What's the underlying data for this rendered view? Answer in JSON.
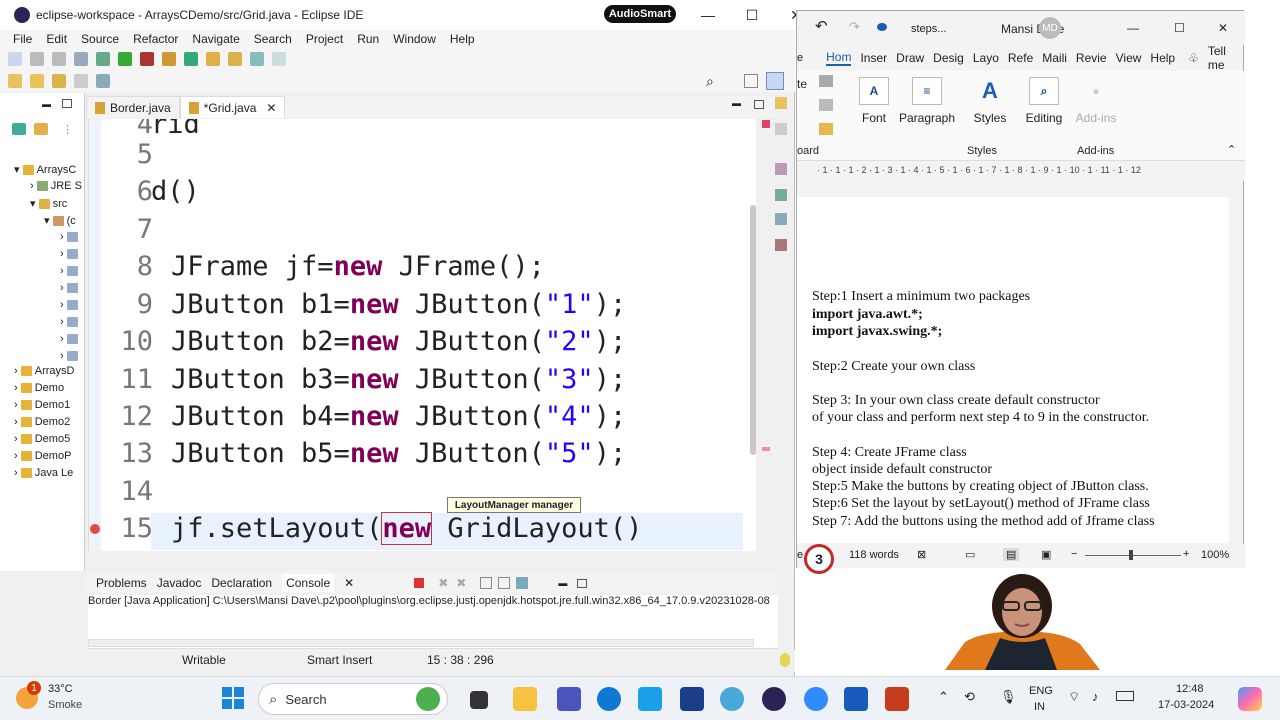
{
  "eclipse": {
    "title": "eclipse-workspace - ArraysCDemo/src/Grid.java - Eclipse IDE",
    "audiosmart": "AudioSmart",
    "menu": [
      "File",
      "Edit",
      "Source",
      "Refactor",
      "Navigate",
      "Search",
      "Project",
      "Run",
      "Window",
      "Help"
    ],
    "tree": [
      "ArraysC",
      "JRE S",
      "src",
      "(c",
      "ArraysD",
      "Demo",
      "Demo1",
      "Demo2",
      "Demo5",
      "DemoP",
      "Java Le"
    ],
    "tabs": {
      "border": "Border.java",
      "grid": "*Grid.java"
    },
    "editor": {
      "lines": [
        {
          "n": "4",
          "code": "rid"
        },
        {
          "n": "5",
          "code": ""
        },
        {
          "n": "6",
          "code": "d()"
        },
        {
          "n": "7",
          "code": ""
        },
        {
          "n": "8",
          "type": "JFrame jf=",
          "kw": "new",
          "rest": " JFrame();"
        },
        {
          "n": "9",
          "type": "JButton b1=",
          "kw": "new",
          "rest": " JButton(",
          "str": "\"1\"",
          "end": ");"
        },
        {
          "n": "10",
          "type": "JButton b2=",
          "kw": "new",
          "rest": " JButton(",
          "str": "\"2\"",
          "end": ");"
        },
        {
          "n": "11",
          "type": "JButton b3=",
          "kw": "new",
          "rest": " JButton(",
          "str": "\"3\"",
          "end": ");"
        },
        {
          "n": "12",
          "type": "JButton b4=",
          "kw": "new",
          "rest": " JButton(",
          "str": "\"4\"",
          "end": ");"
        },
        {
          "n": "13",
          "type": "JButton b5=",
          "kw": "new",
          "rest": " JButton(",
          "str": "\"5\"",
          "end": ");"
        },
        {
          "n": "14",
          "code": ""
        },
        {
          "n": "15",
          "type": "jf.setLayout(",
          "kw": "new",
          "rest": " GridLayout()"
        }
      ],
      "tooltip": "LayoutManager manager"
    },
    "console_tabs": [
      "Problems",
      "Javadoc",
      "Declaration",
      "Console"
    ],
    "console_path": "Border [Java Application] C:\\Users\\Mansi Dave\\.p2\\pool\\plugins\\org.eclipse.justj.openjdk.hotspot.jre.full.win32.x86_64_17.0.9.v20231028-08",
    "status": {
      "mode": "Writable",
      "insert": "Smart Insert",
      "pos": "15 : 38 : 296"
    }
  },
  "word": {
    "title": "steps...",
    "user": "Mansi Dave",
    "initials": "MD",
    "tabs": [
      "Hom",
      "Inser",
      "Draw",
      "Desig",
      "Layo",
      "Refe",
      "Maili",
      "Revie",
      "View",
      "Help",
      "Tell me"
    ],
    "ribbon": {
      "font": "Font",
      "paragraph": "Paragraph",
      "styles": "Styles",
      "editing": "Editing",
      "addins": "Add-ins",
      "styles_grp": "Styles",
      "addins_grp": "Add-ins",
      "board": "oard"
    },
    "ruler": "· 1 · 1 · 1 · 2 · 1 · 3 · 1 · 4 · 1 · 5 · 1 · 6 · 1 · 7 · 1 · 8 · 1 · 9 · 1 · 10 · 1 · 11 · 1 · 12",
    "doc": [
      {
        "t": "Step:1 Insert a minimum two packages",
        "b": false
      },
      {
        "t": "import java.awt.*;",
        "b": true
      },
      {
        "t": "import javax.swing.*;",
        "b": true
      },
      {
        "t": "",
        "b": false
      },
      {
        "t": "Step:2 Create your own class",
        "b": false
      },
      {
        "t": "",
        "b": false
      },
      {
        "t": "Step 3: In your own class create default constructor",
        "b": false
      },
      {
        "t": "of your class and perform next step 4 to 9 in the constructor.",
        "b": false
      },
      {
        "t": "",
        "b": false
      },
      {
        "t": "Step 4: Create JFrame class",
        "b": false
      },
      {
        "t": "object inside default constructor",
        "b": false
      },
      {
        "t": "Step:5 Make the buttons by creating object of JButton class.",
        "b": false
      },
      {
        "t": "Step:6 Set the layout by setLayout() method of JFrame class",
        "b": false
      },
      {
        "t": "Step 7: Add the buttons using the method add of Jframe class",
        "b": false
      }
    ],
    "status": {
      "page": "e",
      "words": "118 words",
      "zoom": "100%"
    },
    "badge": "3"
  },
  "taskbar": {
    "weather_temp": "33°C",
    "weather_desc": "Smoke",
    "weather_badge": "1",
    "search": "Search",
    "lang1": "ENG",
    "lang2": "IN",
    "time": "12:48",
    "date": "17-03-2024"
  }
}
